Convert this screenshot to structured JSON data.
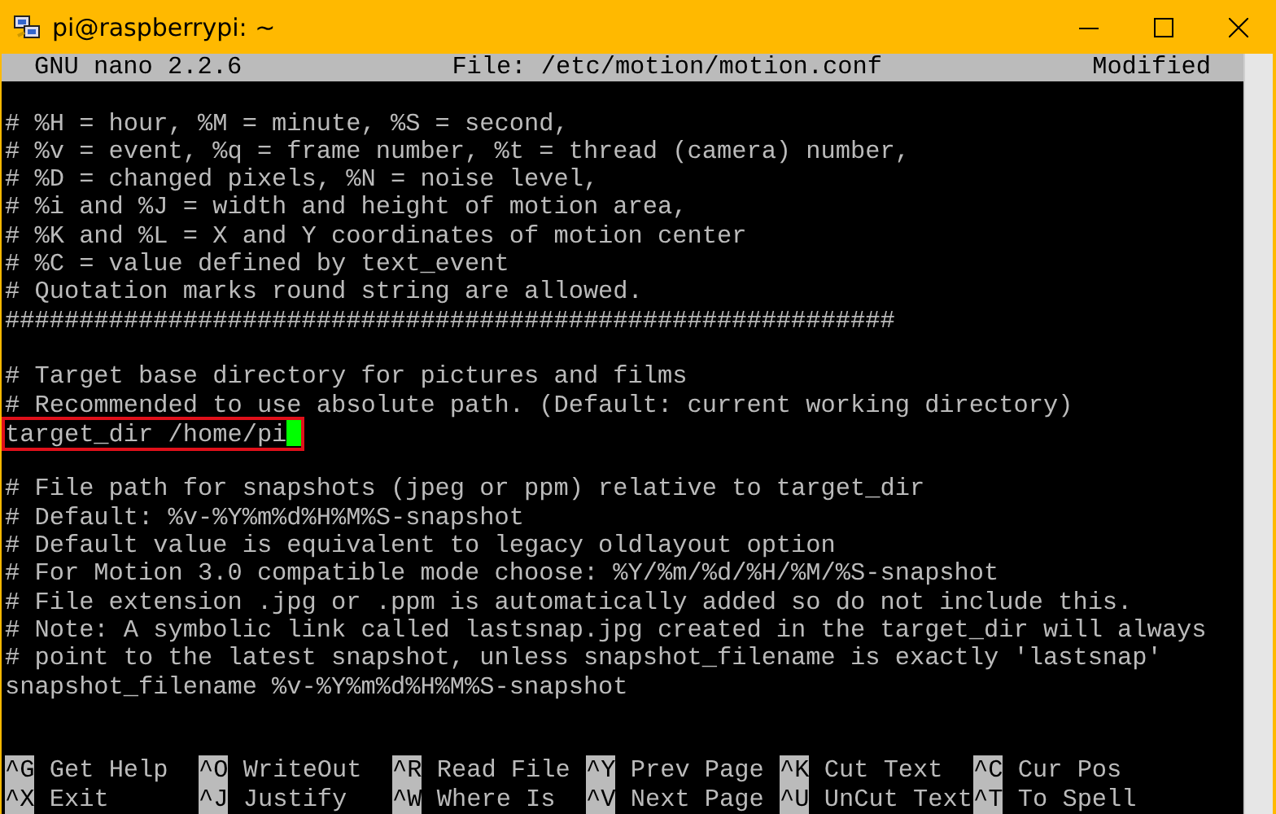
{
  "window": {
    "title": "pi@raspberrypi: ~"
  },
  "header": {
    "app": "GNU nano 2.2.6",
    "file": "File: /etc/motion/motion.conf",
    "status": "Modified"
  },
  "lines": [
    {
      "kind": "blank"
    },
    {
      "kind": "text",
      "text": "# %H = hour, %M = minute, %S = second,"
    },
    {
      "kind": "text",
      "text": "# %v = event, %q = frame number, %t = thread (camera) number,"
    },
    {
      "kind": "text",
      "text": "# %D = changed pixels, %N = noise level,"
    },
    {
      "kind": "text",
      "text": "# %i and %J = width and height of motion area,"
    },
    {
      "kind": "text",
      "text": "# %K and %L = X and Y coordinates of motion center"
    },
    {
      "kind": "text",
      "text": "# %C = value defined by text_event"
    },
    {
      "kind": "text",
      "text": "# Quotation marks round string are allowed."
    },
    {
      "kind": "text",
      "text": "############################################################"
    },
    {
      "kind": "blank"
    },
    {
      "kind": "text",
      "text": "# Target base directory for pictures and films"
    },
    {
      "kind": "text",
      "text": "# Recommended to use absolute path. (Default: current working directory)"
    },
    {
      "kind": "text",
      "text": "target_dir /home/pi",
      "highlighted": true,
      "cursor": true
    },
    {
      "kind": "blank"
    },
    {
      "kind": "text",
      "text": "# File path for snapshots (jpeg or ppm) relative to target_dir"
    },
    {
      "kind": "text",
      "text": "# Default: %v-%Y%m%d%H%M%S-snapshot"
    },
    {
      "kind": "text",
      "text": "# Default value is equivalent to legacy oldlayout option"
    },
    {
      "kind": "text",
      "text": "# For Motion 3.0 compatible mode choose: %Y/%m/%d/%H/%M/%S-snapshot"
    },
    {
      "kind": "text",
      "text": "# File extension .jpg or .ppm is automatically added so do not include this."
    },
    {
      "kind": "text",
      "text": "# Note: A symbolic link called lastsnap.jpg created in the target_dir will always"
    },
    {
      "kind": "text",
      "text": "# point to the latest snapshot, unless snapshot_filename is exactly 'lastsnap'"
    },
    {
      "kind": "text",
      "text": "snapshot_filename %v-%Y%m%d%H%M%S-snapshot"
    },
    {
      "kind": "blank"
    },
    {
      "kind": "blank"
    }
  ],
  "shortcuts": [
    [
      {
        "key": "^G",
        "label": "Get Help"
      },
      {
        "key": "^O",
        "label": "WriteOut"
      },
      {
        "key": "^R",
        "label": "Read File"
      },
      {
        "key": "^Y",
        "label": "Prev Page"
      },
      {
        "key": "^K",
        "label": "Cut Text"
      },
      {
        "key": "^C",
        "label": "Cur Pos"
      }
    ],
    [
      {
        "key": "^X",
        "label": "Exit"
      },
      {
        "key": "^J",
        "label": "Justify"
      },
      {
        "key": "^W",
        "label": "Where Is"
      },
      {
        "key": "^V",
        "label": "Next Page"
      },
      {
        "key": "^U",
        "label": "UnCut Text"
      },
      {
        "key": "^T",
        "label": "To Spell"
      }
    ]
  ]
}
